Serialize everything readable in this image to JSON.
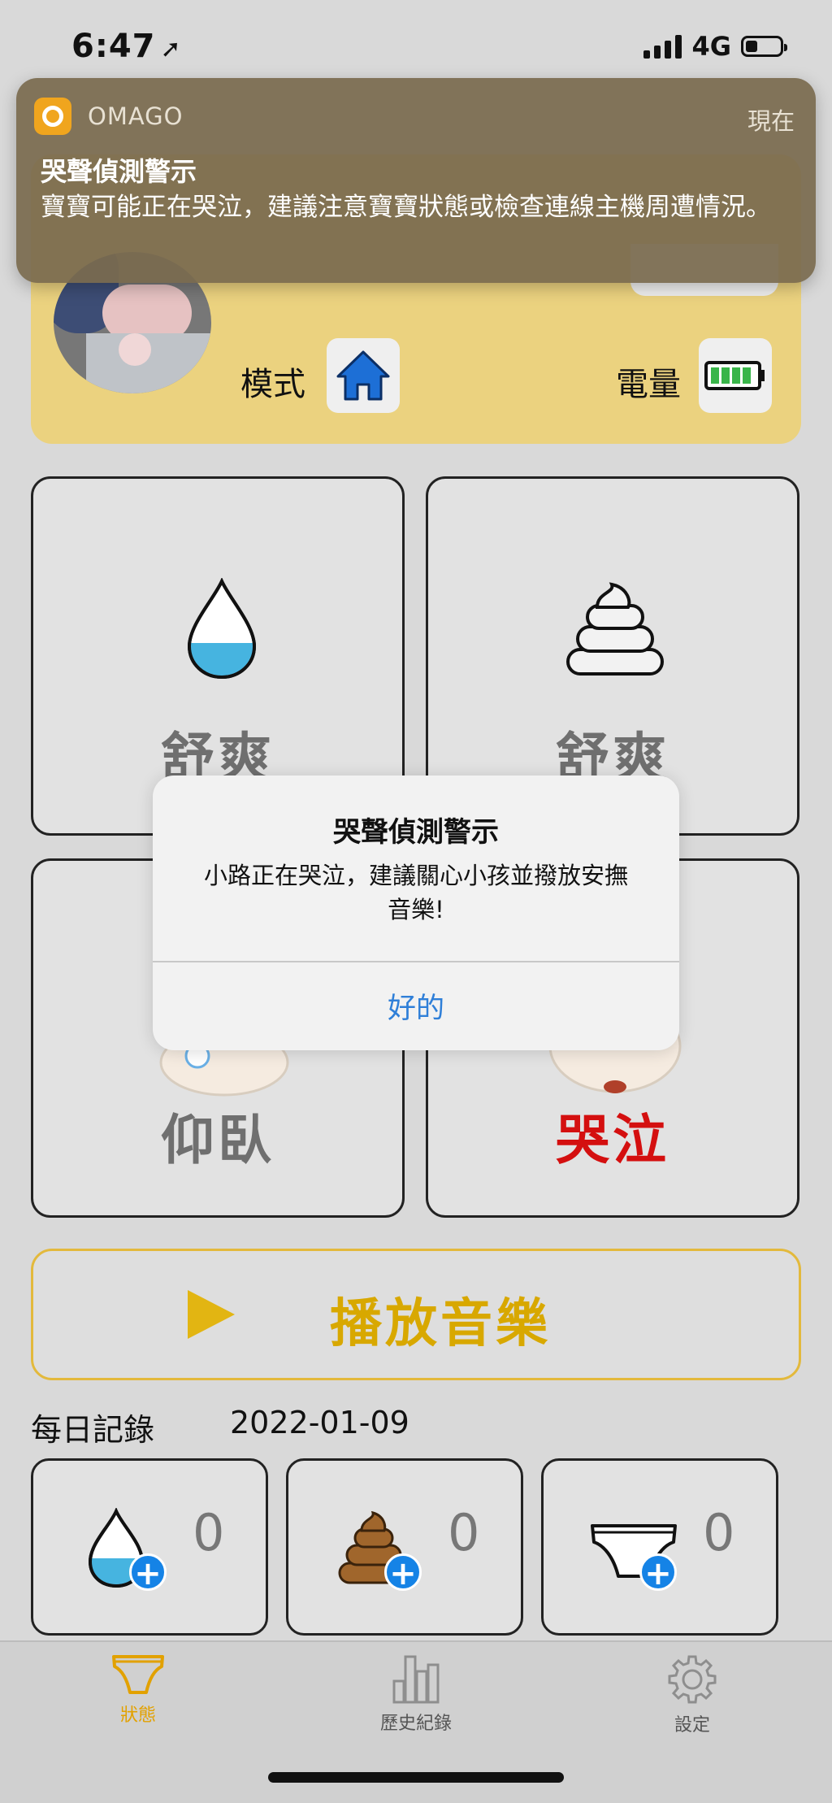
{
  "status_bar": {
    "time": "6:47",
    "network": "4G"
  },
  "notification": {
    "app_name": "OMAGO",
    "time": "現在",
    "title": "哭聲偵測警示",
    "body": "寶寶可能正在哭泣，建議注意寶寶狀態或檢查連線主機周遭情況。"
  },
  "header": {
    "mode_label": "模式",
    "mode_icon": "home-icon",
    "battery_label": "電量",
    "battery_icon": "battery-full-icon"
  },
  "tiles": [
    {
      "icon": "water-drop-icon",
      "status": "舒爽"
    },
    {
      "icon": "poop-icon",
      "status": "舒爽"
    },
    {
      "icon": "baby-sleeping-icon",
      "status": "仰臥"
    },
    {
      "icon": "baby-crying-icon",
      "status": "哭泣"
    }
  ],
  "dialog": {
    "title": "哭聲偵測警示",
    "message": "小路正在哭泣，建議關心小孩並撥放安撫音樂!",
    "ok_label": "好的"
  },
  "play_music": {
    "label": "播放音樂"
  },
  "daily": {
    "title": "每日記錄",
    "date": "2022-01-09",
    "items": [
      {
        "icon": "pee-drop-icon",
        "count": "0"
      },
      {
        "icon": "poop-icon",
        "count": "0"
      },
      {
        "icon": "diaper-icon",
        "count": "0"
      }
    ]
  },
  "tabbar": {
    "active": "狀態",
    "items": [
      {
        "label": "狀態",
        "icon": "diaper-icon"
      },
      {
        "label": "歷史紀錄",
        "icon": "bar-chart-icon"
      },
      {
        "label": "設定",
        "icon": "gear-icon"
      }
    ]
  },
  "colors": {
    "accent": "#e2a100",
    "alert": "#d40f0f",
    "link": "#2f7fd8",
    "card": "#ebd27f"
  }
}
